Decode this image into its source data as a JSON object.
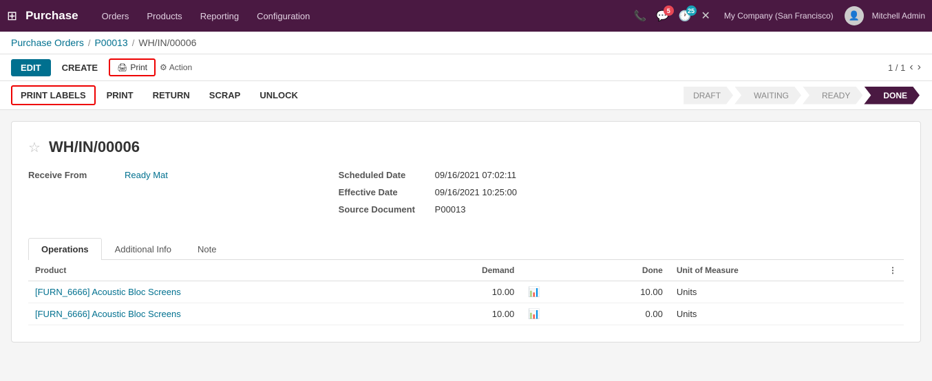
{
  "topnav": {
    "app_name": "Purchase",
    "nav_links": [
      "Orders",
      "Products",
      "Reporting",
      "Configuration"
    ],
    "notification_count": "5",
    "activity_count": "25",
    "company": "My Company (San Francisco)",
    "user": "Mitchell Admin"
  },
  "breadcrumb": {
    "parts": [
      "Purchase Orders",
      "P00013",
      "WH/IN/00006"
    ]
  },
  "actions": {
    "edit": "EDIT",
    "create": "CREATE",
    "print": "Print",
    "action": "Action",
    "pagination": "1 / 1"
  },
  "secondary_actions": {
    "print_labels": "PRINT LABELS",
    "print": "PRINT",
    "return": "RETURN",
    "scrap": "SCRAP",
    "unlock": "UNLOCK"
  },
  "status_steps": [
    "DRAFT",
    "WAITING",
    "READY",
    "DONE"
  ],
  "active_status": "DONE",
  "document": {
    "title": "WH/IN/00006",
    "fields": {
      "receive_from_label": "Receive From",
      "receive_from_value": "Ready Mat",
      "scheduled_date_label": "Scheduled Date",
      "scheduled_date_value": "09/16/2021 07:02:11",
      "effective_date_label": "Effective Date",
      "effective_date_value": "09/16/2021 10:25:00",
      "source_document_label": "Source Document",
      "source_document_value": "P00013"
    }
  },
  "tabs": {
    "items": [
      "Operations",
      "Additional Info",
      "Note"
    ],
    "active": "Operations"
  },
  "table": {
    "columns": [
      "Product",
      "Demand",
      "",
      "Done",
      "Unit of Measure"
    ],
    "rows": [
      {
        "product": "[FURN_6666] Acoustic Bloc Screens",
        "demand": "10.00",
        "done": "10.00",
        "unit": "Units"
      },
      {
        "product": "[FURN_6666] Acoustic Bloc Screens",
        "demand": "10.00",
        "done": "0.00",
        "unit": "Units"
      }
    ]
  }
}
